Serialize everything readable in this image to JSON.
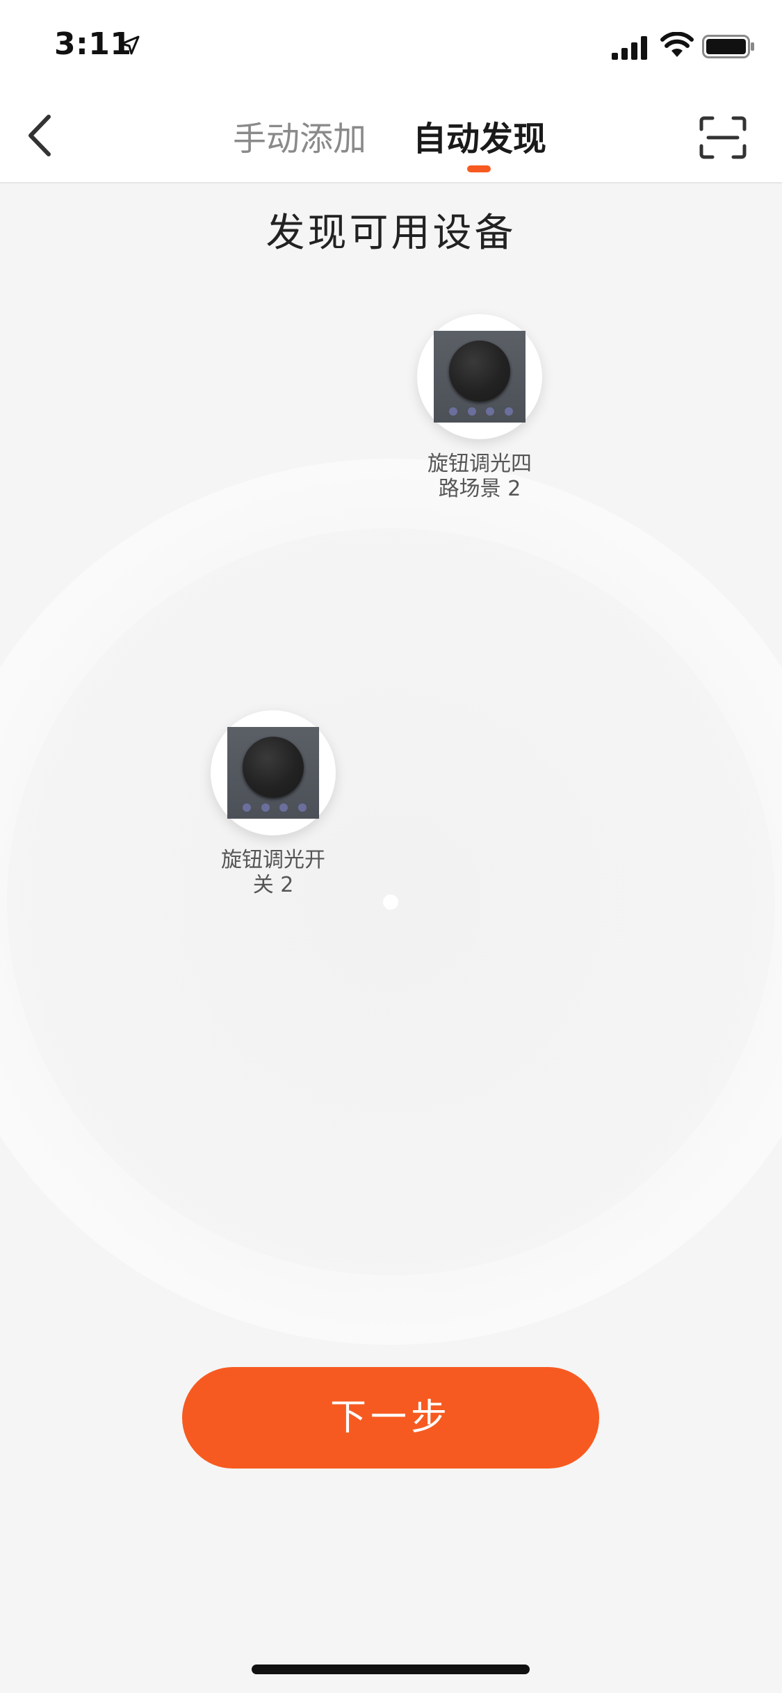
{
  "status_bar": {
    "time": "3:11",
    "icons": [
      "location-arrow-icon",
      "signal-icon",
      "wifi-icon",
      "battery-icon"
    ]
  },
  "header": {
    "back_icon": "chevron-left-icon",
    "tabs": [
      {
        "label": "手动添加",
        "active": false
      },
      {
        "label": "自动发现",
        "active": true
      }
    ],
    "scan_icon": "scan-icon"
  },
  "main": {
    "heading": "发现可用设备",
    "devices": [
      {
        "name": "旋钮调光四路场景 2",
        "line1": "旋钮调光四",
        "line2": "路场景 2"
      },
      {
        "name": "旋钮调光开关 2",
        "line1": "旋钮调光开",
        "line2": "关 2"
      }
    ],
    "next_button_label": "下一步"
  },
  "colors": {
    "accent": "#F75A20",
    "background": "#F5F5F5",
    "active_tab": "#1A1A1A",
    "inactive_tab": "#8A8A8A"
  }
}
